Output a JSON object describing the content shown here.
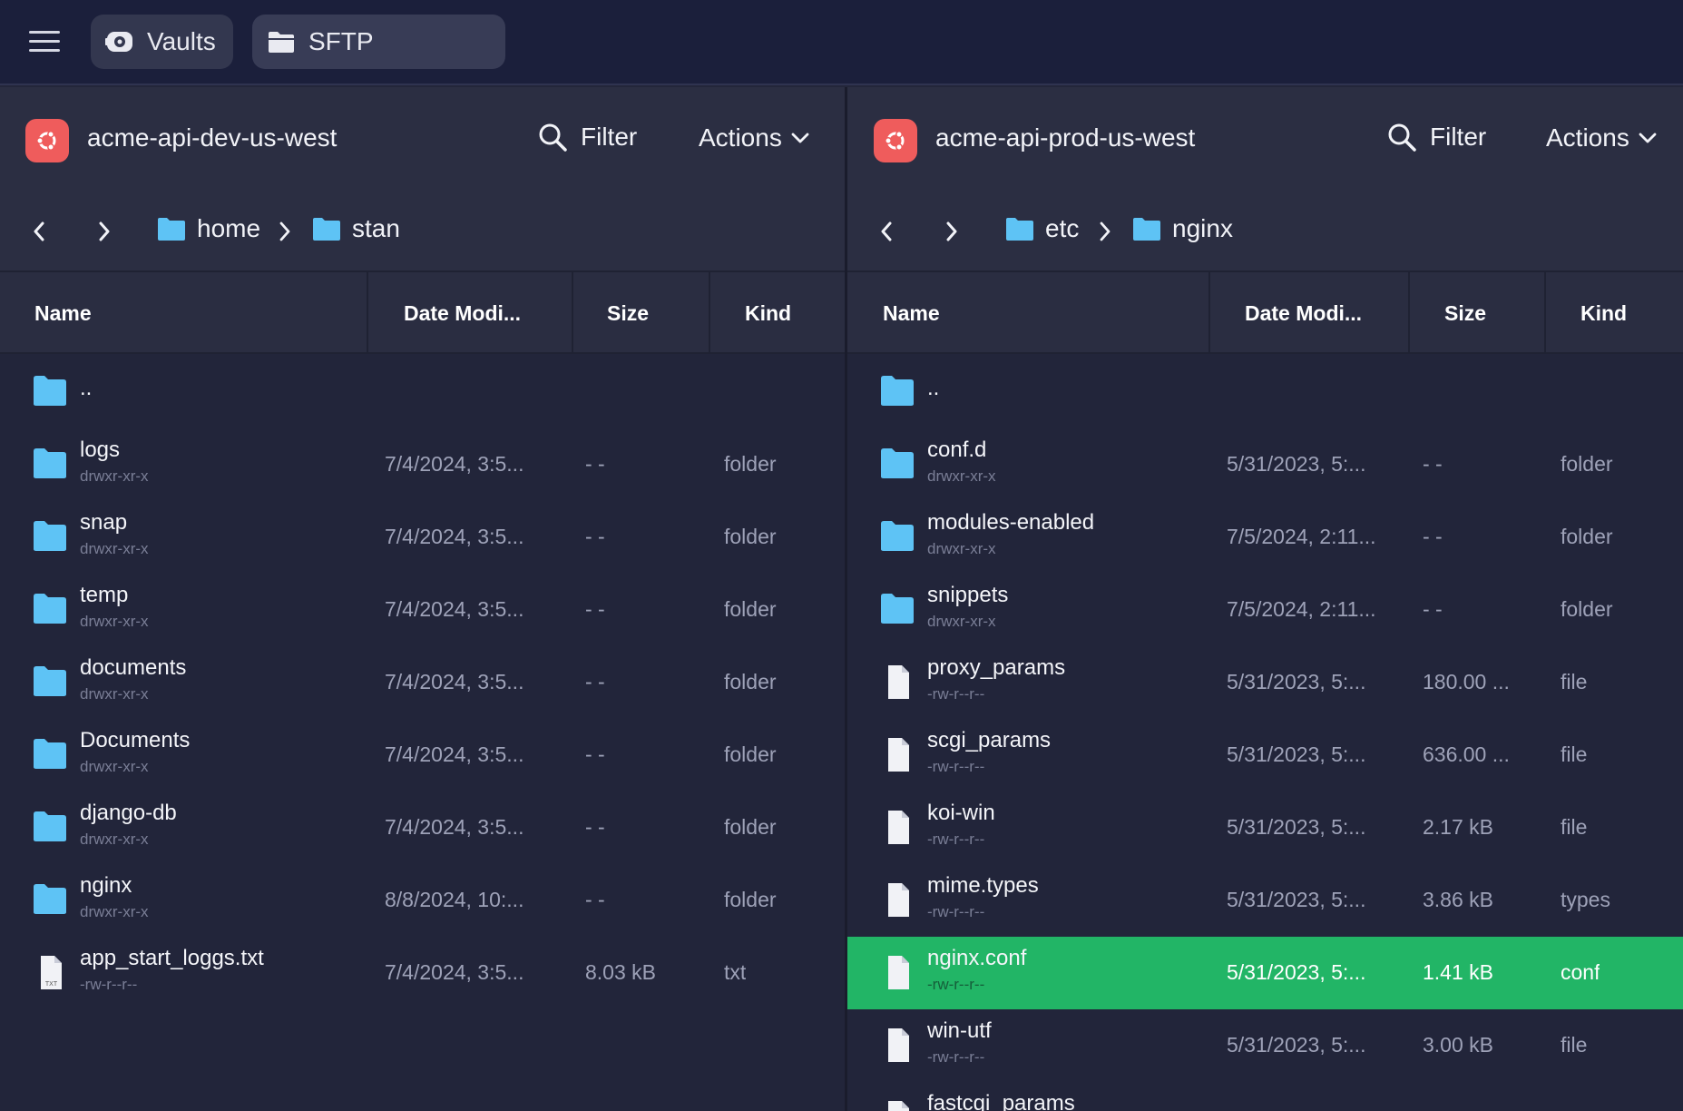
{
  "topbar": {
    "tabs": [
      {
        "label": "Vaults",
        "icon": "vault-icon"
      },
      {
        "label": "SFTP",
        "icon": "folder-icon"
      }
    ]
  },
  "colors": {
    "accent_selected": "#22b566",
    "host_badge": "#ef5c5c",
    "folder": "#5ec3f5"
  },
  "left": {
    "host": "acme-api-dev-us-west",
    "filter_label": "Filter",
    "actions_label": "Actions",
    "breadcrumb": [
      "home",
      "stan"
    ],
    "columns": [
      "Name",
      "Date Modi...",
      "Size",
      "Kind"
    ],
    "rows": [
      {
        "name": "..",
        "perm": "",
        "date": "",
        "size": "",
        "kind": "",
        "type": "folder"
      },
      {
        "name": "logs",
        "perm": "drwxr-xr-x",
        "date": "7/4/2024, 3:5...",
        "size": "- -",
        "kind": "folder",
        "type": "folder"
      },
      {
        "name": "snap",
        "perm": "drwxr-xr-x",
        "date": "7/4/2024, 3:5...",
        "size": "- -",
        "kind": "folder",
        "type": "folder"
      },
      {
        "name": "temp",
        "perm": "drwxr-xr-x",
        "date": "7/4/2024, 3:5...",
        "size": "- -",
        "kind": "folder",
        "type": "folder"
      },
      {
        "name": "documents",
        "perm": "drwxr-xr-x",
        "date": "7/4/2024, 3:5...",
        "size": "- -",
        "kind": "folder",
        "type": "folder"
      },
      {
        "name": "Documents",
        "perm": "drwxr-xr-x",
        "date": "7/4/2024, 3:5...",
        "size": "- -",
        "kind": "folder",
        "type": "folder"
      },
      {
        "name": "django-db",
        "perm": "drwxr-xr-x",
        "date": "7/4/2024, 3:5...",
        "size": "- -",
        "kind": "folder",
        "type": "folder"
      },
      {
        "name": "nginx",
        "perm": "drwxr-xr-x",
        "date": "8/8/2024, 10:...",
        "size": "- -",
        "kind": "folder",
        "type": "folder"
      },
      {
        "name": "app_start_loggs.txt",
        "perm": "-rw-r--r--",
        "date": "7/4/2024, 3:5...",
        "size": "8.03 kB",
        "kind": "txt",
        "type": "txt"
      }
    ]
  },
  "right": {
    "host": "acme-api-prod-us-west",
    "filter_label": "Filter",
    "actions_label": "Actions",
    "breadcrumb": [
      "etc",
      "nginx"
    ],
    "columns": [
      "Name",
      "Date Modi...",
      "Size",
      "Kind"
    ],
    "rows": [
      {
        "name": "..",
        "perm": "",
        "date": "",
        "size": "",
        "kind": "",
        "type": "folder"
      },
      {
        "name": "conf.d",
        "perm": "drwxr-xr-x",
        "date": "5/31/2023, 5:...",
        "size": "- -",
        "kind": "folder",
        "type": "folder"
      },
      {
        "name": "modules-enabled",
        "perm": "drwxr-xr-x",
        "date": "7/5/2024, 2:11...",
        "size": "- -",
        "kind": "folder",
        "type": "folder"
      },
      {
        "name": "snippets",
        "perm": "drwxr-xr-x",
        "date": "7/5/2024, 2:11...",
        "size": "- -",
        "kind": "folder",
        "type": "folder"
      },
      {
        "name": "proxy_params",
        "perm": "-rw-r--r--",
        "date": "5/31/2023, 5:...",
        "size": "180.00 ...",
        "kind": "file",
        "type": "file"
      },
      {
        "name": "scgi_params",
        "perm": "-rw-r--r--",
        "date": "5/31/2023, 5:...",
        "size": "636.00 ...",
        "kind": "file",
        "type": "file"
      },
      {
        "name": "koi-win",
        "perm": "-rw-r--r--",
        "date": "5/31/2023, 5:...",
        "size": "2.17 kB",
        "kind": "file",
        "type": "file"
      },
      {
        "name": "mime.types",
        "perm": "-rw-r--r--",
        "date": "5/31/2023, 5:...",
        "size": "3.86 kB",
        "kind": "types",
        "type": "file"
      },
      {
        "name": "nginx.conf",
        "perm": "-rw-r--r--",
        "date": "5/31/2023, 5:...",
        "size": "1.41 kB",
        "kind": "conf",
        "type": "file",
        "selected": true
      },
      {
        "name": "win-utf",
        "perm": "-rw-r--r--",
        "date": "5/31/2023, 5:...",
        "size": "3.00 kB",
        "kind": "file",
        "type": "file"
      },
      {
        "name": "fastcgi_params",
        "perm": "",
        "date": "",
        "size": "",
        "kind": "",
        "type": "file"
      }
    ]
  }
}
